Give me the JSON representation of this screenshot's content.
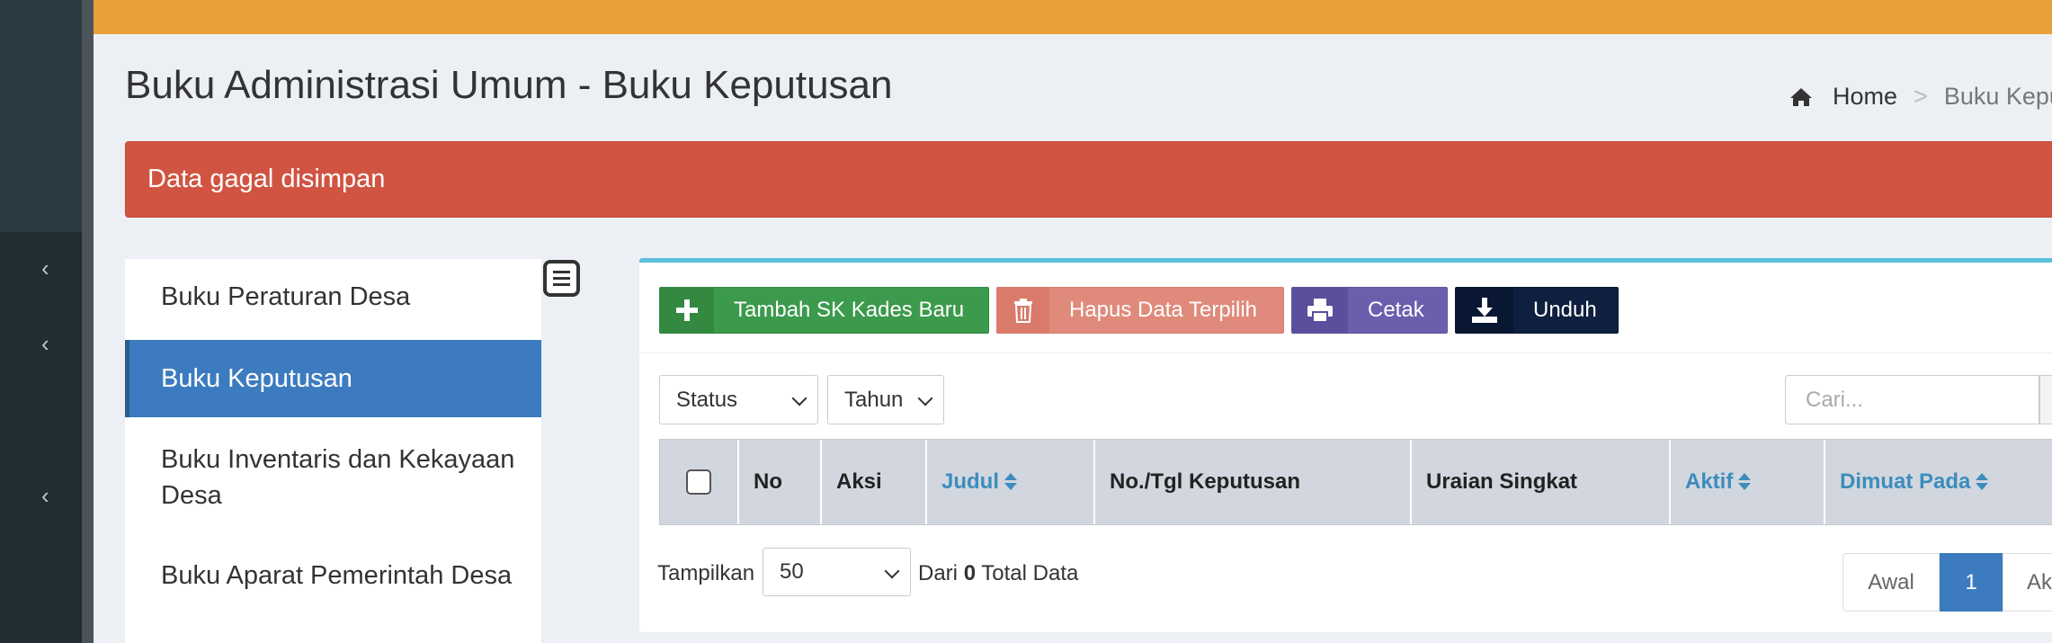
{
  "page": {
    "title": "Buku Administrasi Umum - Buku Keputusan",
    "breadcrumb": {
      "home": "Home",
      "separator": ">",
      "current": "Buku Kepu"
    }
  },
  "alert": {
    "message": "Data gagal disimpan",
    "color": "#d05441"
  },
  "sidebar": {
    "chevron": "‹"
  },
  "menu": {
    "items": [
      {
        "label": "Buku Peraturan Desa"
      },
      {
        "label": "Buku Keputusan",
        "active": true
      },
      {
        "label": "Buku Inventaris dan Kekayaan Desa"
      },
      {
        "label": "Buku Aparat Pemerintah Desa"
      }
    ]
  },
  "toolbar": {
    "add_label": "Tambah SK Kades Baru",
    "delete_label": "Hapus Data Terpilih",
    "print_label": "Cetak",
    "download_label": "Unduh"
  },
  "filters": {
    "status": "Status",
    "tahun": "Tahun",
    "search_placeholder": "Cari..."
  },
  "table": {
    "columns": {
      "no": "No",
      "aksi": "Aksi",
      "judul": "Judul",
      "no_tgl": "No./Tgl Keputusan",
      "uraian": "Uraian Singkat",
      "aktif": "Aktif",
      "dimuat": "Dimuat Pada"
    }
  },
  "footer": {
    "show_label": "Tampilkan",
    "page_length": "50",
    "from_label": "Dari",
    "total_count": "0",
    "total_label": "Total Data"
  },
  "pagination": {
    "first": "Awal",
    "current": "1",
    "next": "Ak"
  },
  "colors": {
    "accent": "#3c7bbf",
    "topbar": "#e9a03b",
    "box_border": "#5bc0de"
  }
}
